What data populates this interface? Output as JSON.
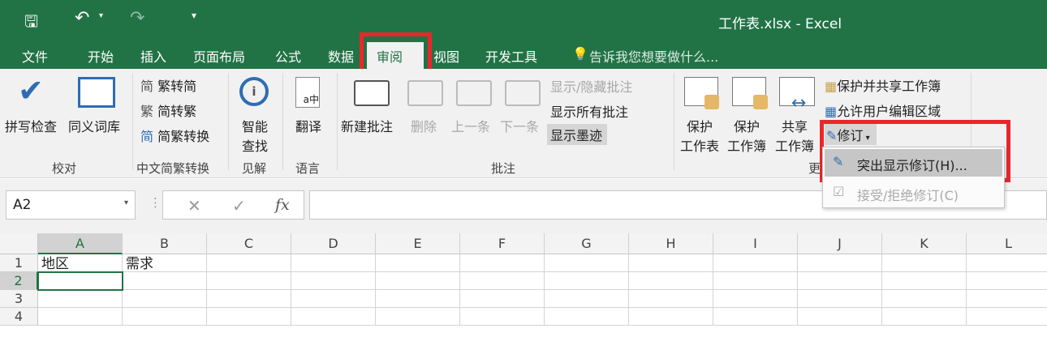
{
  "title": "工作表.xlsx - Excel",
  "tabs": [
    "文件",
    "开始",
    "插入",
    "页面布局",
    "公式",
    "数据",
    "审阅",
    "视图",
    "开发工具"
  ],
  "tell_me": "告诉我您想要做什么...",
  "ribbon": {
    "proofing": {
      "spell": "拼写检查",
      "thesaurus": "同义词库",
      "group": "校对"
    },
    "chinese": {
      "t2s": "繁转简",
      "s2t": "简转繁",
      "convert": "简繁转换",
      "group": "中文简繁转换"
    },
    "insights": {
      "smart1": "智能",
      "smart2": "查找",
      "group": "见解"
    },
    "language": {
      "translate": "翻译",
      "group": "语言"
    },
    "comments": {
      "new": "新建批注",
      "delete": "删除",
      "prev": "上一条",
      "next": "下一条",
      "showhide": "显示/隐藏批注",
      "showall": "显示所有批注",
      "ink": "显示墨迹",
      "group": "批注"
    },
    "changes": {
      "protect_sheet1": "保护",
      "protect_sheet2": "工作表",
      "protect_wb1": "保护",
      "protect_wb2": "工作簿",
      "share1": "共享",
      "share2": "工作簿",
      "protect_share": "保护并共享工作簿",
      "allow_edit": "允许用户编辑区域",
      "track": "修订",
      "group": "更"
    }
  },
  "menu": {
    "highlight": "突出显示修订(H)...",
    "accept": "接受/拒绝修订(C)"
  },
  "namebox": "A2",
  "fx": "fx",
  "columns": [
    "A",
    "B",
    "C",
    "D",
    "E",
    "F",
    "G",
    "H",
    "I",
    "J",
    "K",
    "L"
  ],
  "rows": [
    "1",
    "2",
    "3",
    "4"
  ],
  "cells": {
    "A1": "地区",
    "B1": "需求"
  }
}
